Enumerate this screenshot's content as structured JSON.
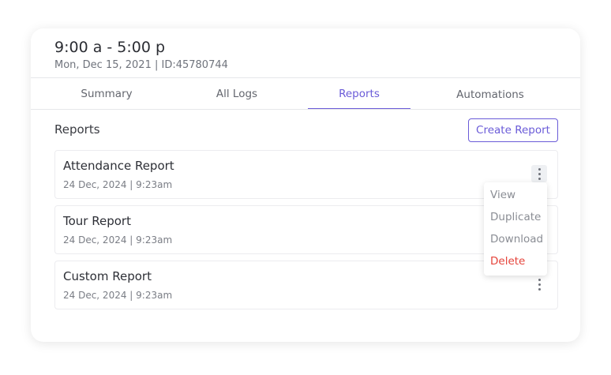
{
  "header": {
    "time_range": "9:00 a - 5:00 p",
    "meta": "Mon, Dec 15, 2021 | ID:45780744"
  },
  "tabs": [
    {
      "label": "Summary"
    },
    {
      "label": "All Logs"
    },
    {
      "label": "Reports",
      "active": true
    },
    {
      "label": "Automations"
    }
  ],
  "reports_section": {
    "title": "Reports",
    "create_button": "Create Report"
  },
  "reports": [
    {
      "name": "Attendance Report",
      "date": "24 Dec, 2024 | 9:23am"
    },
    {
      "name": "Tour Report",
      "date": "24 Dec, 2024 | 9:23am"
    },
    {
      "name": "Custom Report",
      "date": "24 Dec, 2024 | 9:23am"
    }
  ],
  "context_menu": {
    "items": [
      {
        "label": "View"
      },
      {
        "label": "Duplicate"
      },
      {
        "label": "Download"
      },
      {
        "label": "Delete",
        "danger": true
      }
    ]
  },
  "colors": {
    "accent": "#6a5bd8",
    "danger": "#e5443b",
    "text": "#2d2f36",
    "muted": "#7a7d85"
  }
}
